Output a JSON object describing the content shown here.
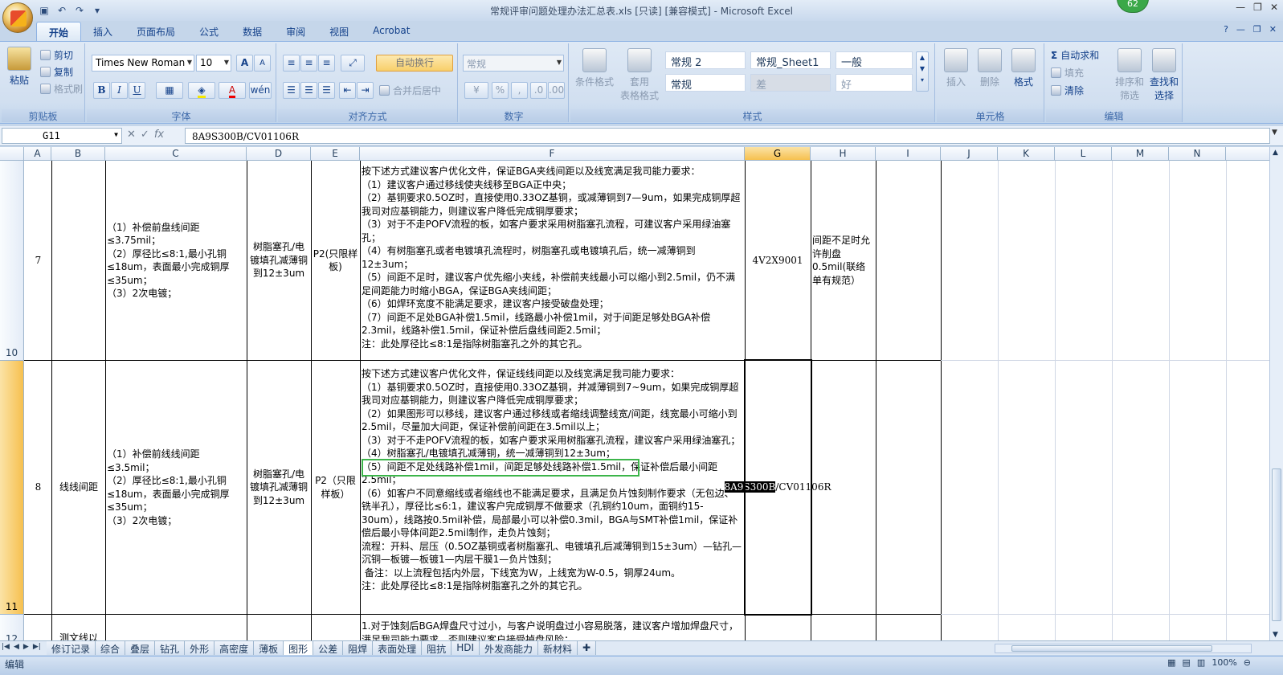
{
  "window": {
    "title": "常规评审问题处理办法汇总表.xls  [只读]  [兼容模式] - Microsoft Excel",
    "badge": "62"
  },
  "tabs": [
    "开始",
    "插入",
    "页面布局",
    "公式",
    "数据",
    "审阅",
    "视图",
    "Acrobat"
  ],
  "ribbon": {
    "clipboard": {
      "paste": "粘贴",
      "cut": "剪切",
      "copy": "复制",
      "format_painter": "格式刷",
      "label": "剪贴板"
    },
    "font": {
      "name": "Times New Roman",
      "size": "10",
      "bold": "B",
      "italic": "I",
      "underline": "U",
      "label": "字体",
      "grow": "A",
      "shrink": "A"
    },
    "alignment": {
      "wrap": "自动换行",
      "merge": "合并后居中",
      "label": "对齐方式"
    },
    "number": {
      "format": "常规",
      "percent": "%",
      "label": "数字"
    },
    "styles": {
      "conditional": "条件格式",
      "table_line1": "套用",
      "table_line2": "表格格式",
      "cells": [
        "常规 2",
        "常规_Sheet1",
        "一般",
        "常规",
        "差",
        "好"
      ],
      "label": "样式"
    },
    "cells_group": {
      "insert": "插入",
      "delete": "删除",
      "format": "格式",
      "label": "单元格"
    },
    "editing": {
      "autosum": "自动求和",
      "fill": "填充",
      "clear": "清除",
      "sort_line1": "排序和",
      "sort_line2": "筛选",
      "find_line1": "查找和",
      "find_line2": "选择",
      "label": "编辑"
    }
  },
  "formula_bar": {
    "name_box": "G11",
    "cancel": "✕",
    "enter": "✓",
    "fx": "fx",
    "content": "8A9S300B/CV01106R"
  },
  "columns": [
    "A",
    "B",
    "C",
    "D",
    "E",
    "F",
    "G",
    "H",
    "I",
    "J",
    "K",
    "L",
    "M",
    "N"
  ],
  "rows": {
    "r10": {
      "num": "10",
      "a": "7",
      "c": "（1）补偿前盘线间距≤3.75mil；\n（2）厚径比≤8:1,最小孔铜≤18um，表面最小完成铜厚≤35um；\n（3）2次电镀；",
      "d": "树脂塞孔/电镀填孔减薄铜到12±3um",
      "e": "P2(只限样板)",
      "f": "按下述方式建议客户优化文件，保证BGA夹线间距以及线宽满足我司能力要求：\n（1）建议客户通过移线使夹线移至BGA正中央；\n（2）基铜要求0.5OZ时，直接使用0.33OZ基铜，或减薄铜到7—9um，如果完成铜厚超我司对应基铜能力，则建议客户降低完成铜厚要求；\n（3）对于不走POFV流程的板，如客户要求采用树脂塞孔流程，可建议客户采用绿油塞孔；\n（4）有树脂塞孔或者电镀填孔流程时，树脂塞孔或电镀填孔后，统一减薄铜到12±3um；\n（5）间距不足时，建议客户优先缩小夹线，补偿前夹线最小可以缩小到2.5mil，仍不满足间距能力时缩小BGA，保证BGA夹线间距；\n（6）如焊环宽度不能满足要求，建议客户接受破盘处理；\n（7）间距不足处BGA补偿1.5mil，线路最小补偿1mil，对于间距足够处BGA补偿2.3mil，线路补偿1.5mil，保证补偿后盘线间距2.5mil；\n注：此处厚径比≤8:1是指除树脂塞孔之外的其它孔。",
      "g": "4V2X9001",
      "h": "间距不足时允许削盘0.5mil(联络单有规范）"
    },
    "r11": {
      "num": "11",
      "a": "8",
      "b": "线线间距",
      "c": "（1）补偿前线线间距≤3.5mil；\n（2）厚径比≤8:1,最小孔铜≤18um，表面最小完成铜厚≤35um；\n（3）2次电镀；",
      "d": "树脂塞孔/电镀填孔减薄铜到12±3um",
      "e": "P2（只限样板）",
      "f_before": "按下述方式建议客户优化文件，保证线线间距以及线宽满足我司能力要求：\n（1）基铜要求0.5OZ时，直接使用0.33OZ基铜，并减薄铜到7~9um，如果完成铜厚超我司对应基铜能力，则建议客户降低完成铜厚要求；\n（2）如果图形可以移线，建议客户通过移线或者缩线调整线宽/间距，线宽最小可缩小到2.5mil，尽量加大间距，保证补偿前间距在3.5mil以上；\n（3）对于不走POFV流程的板，如客户要求采用树脂塞孔流程，建议客户采用绿油塞孔；",
      "f_highlight": "（4）树脂塞孔/电镀填孔减薄铜，统一减薄铜到12±3um；",
      "f_after": "（5）间距不足处线路补偿1mil，间距足够处线路补偿1.5mil，保证补偿后最小间距2.5mil；\n（6）如客户不同意缩线或者缩线也不能满足要求，且满足负片蚀刻制作要求（无包边、铣半孔），厚径比≤6:1，建议客户完成铜厚不做要求（孔铜约10um，面铜约15-30um），线路按0.5mil补偿，局部最小可以补偿0.3mil，BGA与SMT补偿1mil，保证补偿后最小导体间距2.5mil制作，走负片蚀刻；\n流程：开料、层压（0.5OZ基铜或者树脂塞孔、电镀填孔后减薄铜到15±3um）—钻孔—沉铜—板镀—板镀1—内层干膜1—负片蚀刻；\n 备注：以上流程包括内外层，下线宽为W，上线宽为W-0.5，铜厚24um。\n注：此处厚径比≤8:1是指除树脂塞孔之外的其它孔。",
      "g_selected": "8A9S300B",
      "g_rest": "/CV01106R"
    },
    "r12": {
      "num": "12",
      "b": "测文线以",
      "f": "1.对于蚀刻后BGA焊盘尺寸过小，与客户说明盘过小容易脱落，建议客户增加焊盘尺寸，满足我司能力要求，否则建议客户接受掉盘风险；"
    }
  },
  "sheet_tabs": [
    "修订记录",
    "综合",
    "叠层",
    "钻孔",
    "外形",
    "高密度",
    "薄板",
    "图形",
    "公差",
    "阻焊",
    "表面处理",
    "阻抗",
    "HDI",
    "外发商能力",
    "新材料"
  ],
  "active_sheet": "图形",
  "status": {
    "mode": "编辑",
    "zoom": "100%"
  }
}
